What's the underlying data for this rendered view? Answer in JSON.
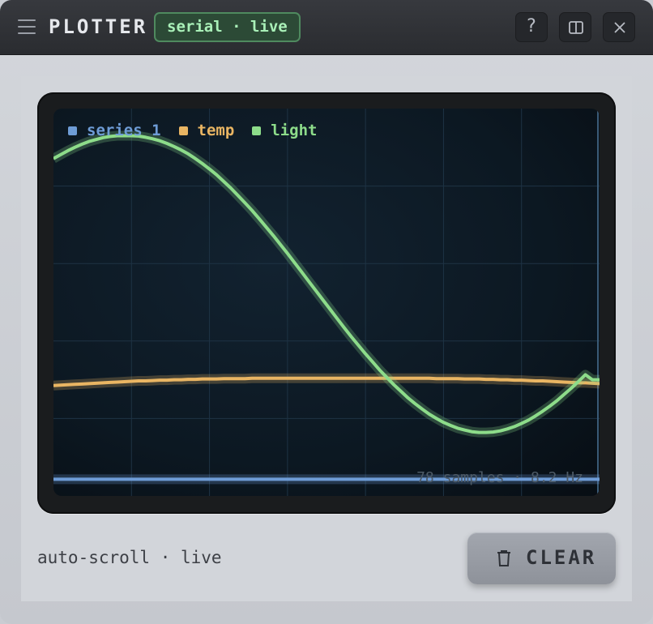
{
  "window": {
    "title": "PLOTTER",
    "status_badge": "serial · live",
    "help_label": "?"
  },
  "legend": [
    {
      "name": "series 1",
      "color": "#6e9cd6"
    },
    {
      "name": "temp",
      "color": "#e9b563"
    },
    {
      "name": "light",
      "color": "#8ddc8a"
    }
  ],
  "stats": "78 samples · 8.2 Hz",
  "footer": {
    "mode_label": "auto-scroll · live",
    "clear_label": "CLEAR"
  },
  "icons": [
    "menu-icon",
    "help-icon",
    "split-view-icon",
    "close-icon",
    "trash-icon"
  ],
  "chart_data": {
    "type": "line",
    "series": [
      {
        "name": "series 1",
        "color": "#6e9cd6",
        "values": [
          0.043,
          0.043,
          0.043,
          0.043,
          0.043,
          0.043,
          0.043,
          0.043,
          0.043,
          0.043,
          0.043,
          0.043,
          0.043,
          0.043,
          0.043,
          0.043,
          0.043,
          0.043,
          0.043,
          0.043,
          0.043,
          0.043,
          0.043,
          0.043,
          0.043,
          0.043,
          0.043,
          0.043,
          0.043,
          0.043,
          0.043,
          0.043,
          0.043,
          0.043,
          0.043,
          0.043,
          0.043,
          0.043,
          0.043,
          0.043,
          0.043,
          0.043,
          0.043,
          0.043,
          0.043,
          0.043,
          0.043,
          0.043,
          0.043,
          0.043,
          0.043,
          0.043,
          0.043,
          0.043,
          0.043,
          0.043,
          0.043,
          0.043,
          0.043,
          0.043,
          0.043,
          0.043,
          0.043,
          0.043,
          0.043,
          0.043,
          0.043,
          0.043,
          0.043,
          0.043,
          0.043,
          0.043,
          0.043,
          0.043,
          0.043,
          0.043,
          0.043,
          0.043
        ]
      },
      {
        "name": "temp",
        "color": "#e9b563",
        "values": [
          0.285,
          0.286,
          0.287,
          0.288,
          0.289,
          0.29,
          0.291,
          0.292,
          0.293,
          0.294,
          0.295,
          0.296,
          0.297,
          0.297,
          0.298,
          0.299,
          0.299,
          0.3,
          0.3,
          0.301,
          0.301,
          0.302,
          0.302,
          0.302,
          0.303,
          0.303,
          0.303,
          0.303,
          0.304,
          0.304,
          0.304,
          0.304,
          0.304,
          0.304,
          0.304,
          0.304,
          0.304,
          0.304,
          0.304,
          0.304,
          0.304,
          0.304,
          0.304,
          0.304,
          0.304,
          0.304,
          0.304,
          0.304,
          0.304,
          0.304,
          0.304,
          0.304,
          0.304,
          0.304,
          0.303,
          0.303,
          0.303,
          0.303,
          0.302,
          0.302,
          0.302,
          0.301,
          0.301,
          0.3,
          0.3,
          0.299,
          0.299,
          0.298,
          0.297,
          0.297,
          0.296,
          0.295,
          0.294,
          0.293,
          0.292,
          0.292,
          0.291,
          0.29
        ]
      },
      {
        "name": "light",
        "color": "#8ddc8a",
        "values": [
          0.871,
          0.881,
          0.891,
          0.9,
          0.908,
          0.915,
          0.92,
          0.925,
          0.928,
          0.93,
          0.93,
          0.93,
          0.929,
          0.926,
          0.922,
          0.917,
          0.91,
          0.902,
          0.893,
          0.883,
          0.871,
          0.858,
          0.844,
          0.829,
          0.812,
          0.795,
          0.776,
          0.757,
          0.737,
          0.716,
          0.694,
          0.672,
          0.649,
          0.626,
          0.602,
          0.578,
          0.554,
          0.53,
          0.506,
          0.482,
          0.458,
          0.434,
          0.411,
          0.389,
          0.367,
          0.346,
          0.325,
          0.306,
          0.287,
          0.27,
          0.253,
          0.238,
          0.224,
          0.211,
          0.2,
          0.19,
          0.182,
          0.175,
          0.17,
          0.166,
          0.164,
          0.164,
          0.165,
          0.168,
          0.173,
          0.179,
          0.187,
          0.196,
          0.207,
          0.219,
          0.232,
          0.246,
          0.262,
          0.278,
          0.295,
          0.313,
          0.3,
          0.3
        ]
      }
    ],
    "ylim": [
      0,
      1
    ],
    "grid": true,
    "legend_position": "top-left"
  }
}
